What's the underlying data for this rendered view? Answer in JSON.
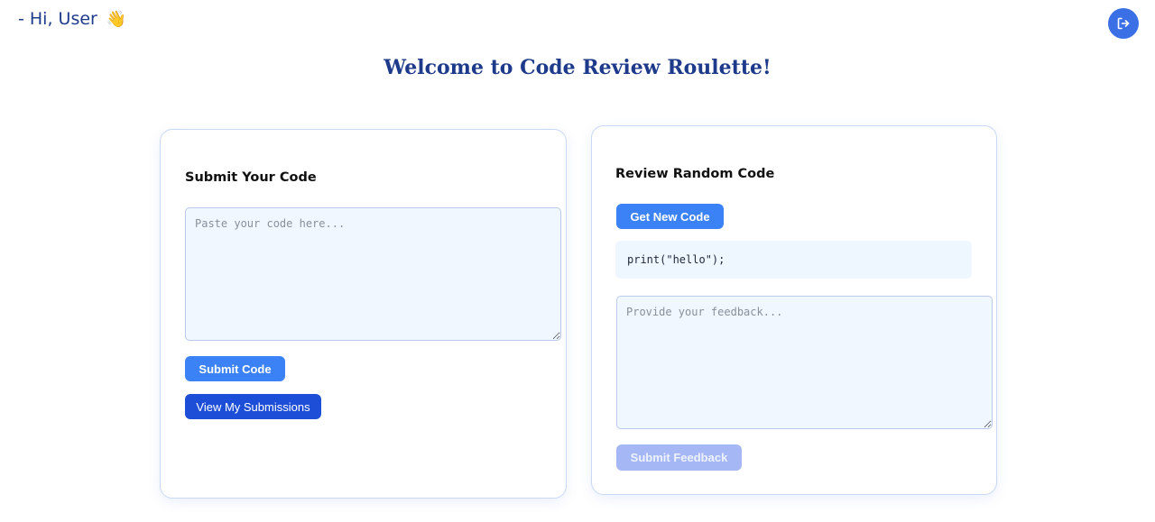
{
  "header": {
    "greeting": "- Hi, User",
    "wave_emoji": "👋",
    "logout_icon": "logout-icon"
  },
  "title": "Welcome to Code Review Roulette!",
  "submit_panel": {
    "heading": "Submit Your Code",
    "code_placeholder": "Paste your code here...",
    "code_value": "",
    "submit_label": "Submit Code",
    "view_label": "View My Submissions"
  },
  "review_panel": {
    "heading": "Review Random Code",
    "get_code_label": "Get New Code",
    "code_snippet": "print(\"hello\");",
    "feedback_placeholder": "Provide your feedback...",
    "feedback_value": "",
    "submit_feedback_label": "Submit Feedback"
  },
  "colors": {
    "accent": "#3b82f6",
    "dark_button": "#1d4ed8",
    "title": "#1e3a8a",
    "disabled_button": "#a5b8f5"
  }
}
